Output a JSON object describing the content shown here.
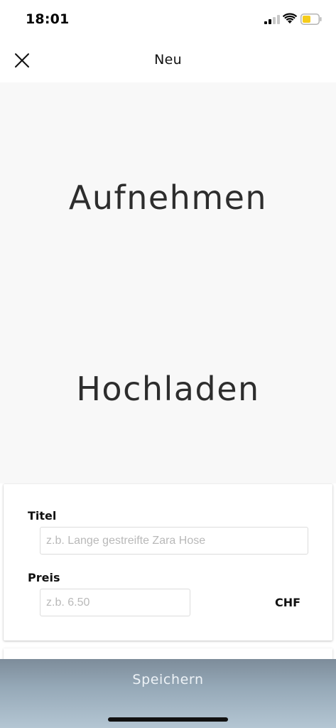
{
  "status_bar": {
    "time": "18:01",
    "icons": [
      "signal-icon",
      "wifi-icon",
      "battery-icon"
    ],
    "battery_color": "#f5cc1b"
  },
  "nav": {
    "title": "Neu",
    "close_icon": "close-icon"
  },
  "photo_area": {
    "capture_label": "Aufnehmen",
    "upload_label": "Hochladen"
  },
  "form": {
    "title_label": "Titel",
    "title_placeholder": "z.b. Lange gestreifte Zara Hose",
    "title_value": "",
    "price_label": "Preis",
    "price_placeholder": "z.b. 6.50",
    "price_value": "",
    "currency": "CHF"
  },
  "footer": {
    "save_label": "Speichern"
  }
}
